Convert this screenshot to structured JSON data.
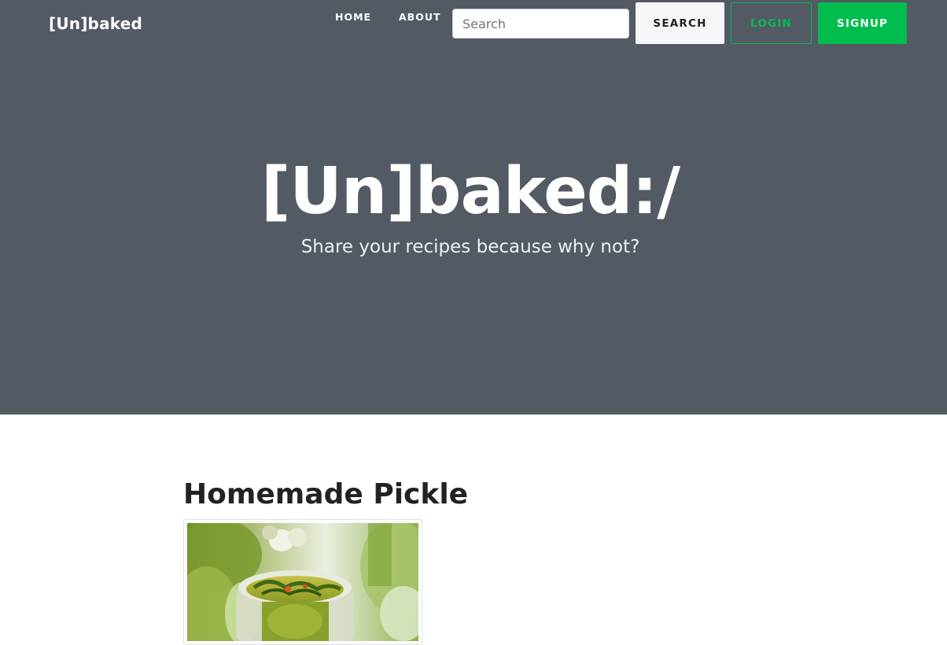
{
  "navbar": {
    "brand": "[Un]baked",
    "links": [
      {
        "label": "HOME"
      },
      {
        "label": "ABOUT"
      }
    ],
    "search": {
      "placeholder": "Search",
      "value": "",
      "button_label": "SEARCH"
    },
    "login_label": "LOGIN",
    "signup_label": "SIGNUP"
  },
  "hero": {
    "title": "[Un]baked:/",
    "subtitle": "Share your recipes because why not?"
  },
  "recipes": [
    {
      "title": "Homemade Pickle",
      "image": "pickle-jar-photo"
    }
  ],
  "colors": {
    "hero_bg": "#535a64",
    "accent_green": "#00bd4e",
    "search_button_bg": "#f5f6f8"
  }
}
